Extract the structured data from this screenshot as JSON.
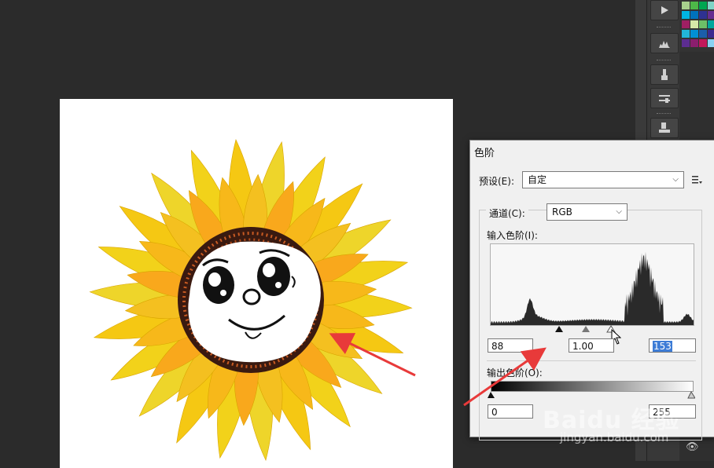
{
  "dialog": {
    "title": "色阶",
    "preset_label": "预设(E):",
    "preset_value": "自定",
    "channel_label": "通道(C):",
    "channel_value": "RGB",
    "input_levels_label": "输入色阶(I):",
    "input_black": "88",
    "input_gamma": "1.00",
    "input_white": "153",
    "output_levels_label": "输出色阶(O):",
    "output_black": "0",
    "output_white": "255"
  },
  "watermark": {
    "brand": "Baidu 经验",
    "url": "jingyan.baidu.com"
  },
  "colors": {
    "workspace": "#2b2b2b",
    "annotation_arrow": "#e83a3a",
    "highlight": "#3d7cd6"
  },
  "icons": {
    "play": "play-icon",
    "histogram": "histogram-icon",
    "brush": "brush-icon",
    "adjust": "adjust-icon",
    "stamp": "stamp-icon",
    "eye": "eye-icon"
  }
}
